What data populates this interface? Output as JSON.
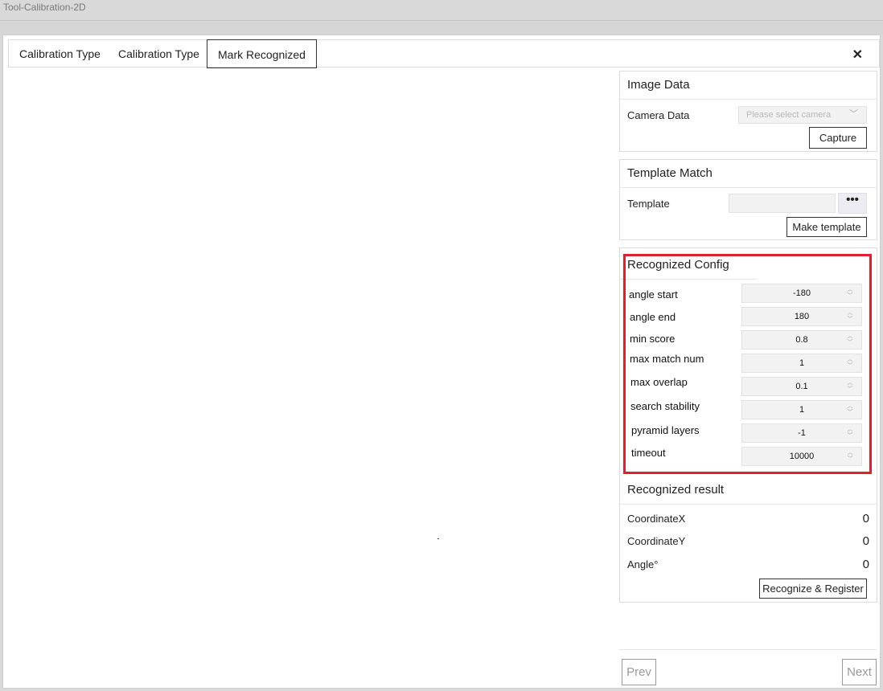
{
  "window_title": "Tool-Calibration-2D",
  "tabs": [
    {
      "label": "Calibration Type"
    },
    {
      "label": "Calibration Type"
    },
    {
      "label": "Mark Recognized"
    }
  ],
  "close_glyph": "✕",
  "image_data": {
    "title": "Image Data",
    "camera_label": "Camera Data",
    "camera_placeholder": "Please select camera",
    "capture_label": "Capture"
  },
  "template_match": {
    "title": "Template Match",
    "template_label": "Template",
    "template_value": "",
    "browse_glyph": "•••",
    "make_template_label": "Make template"
  },
  "recognized_config": {
    "title": "Recognized Config",
    "fields": [
      {
        "label": "angle start",
        "value": "-180"
      },
      {
        "label": "angle end",
        "value": "180"
      },
      {
        "label": "min score",
        "value": "0.8"
      },
      {
        "label": "max match num",
        "value": "1"
      },
      {
        "label": "max overlap",
        "value": "0.1"
      },
      {
        "label": "search stability",
        "value": "1"
      },
      {
        "label": "pyramid layers",
        "value": "-1"
      },
      {
        "label": "timeout",
        "value": "10000"
      }
    ],
    "highlight_color": "#e0202c"
  },
  "recognized_result": {
    "title": "Recognized result",
    "rows": [
      {
        "label": "CoordinateX",
        "value": "0"
      },
      {
        "label": "CoordinateY",
        "value": "0"
      },
      {
        "label": "Angle°",
        "value": "0"
      }
    ],
    "action_label": "Recognize & Register"
  },
  "footer": {
    "prev_label": "Prev",
    "next_label": "Next"
  }
}
